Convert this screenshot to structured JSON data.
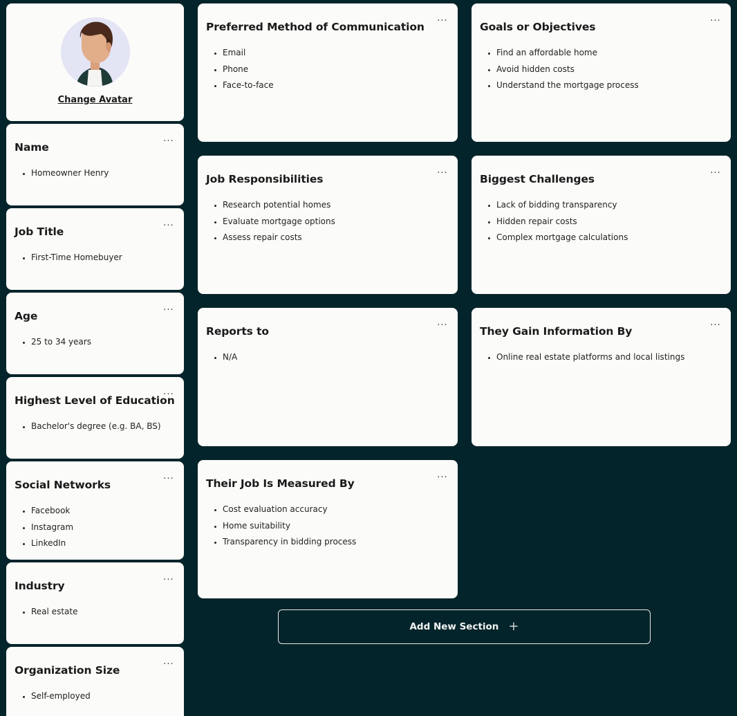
{
  "avatar": {
    "change_label": "Change Avatar"
  },
  "left_cards": [
    {
      "title": "Name",
      "items": [
        "Homeowner Henry"
      ]
    },
    {
      "title": "Job Title",
      "items": [
        "First-Time Homebuyer"
      ]
    },
    {
      "title": "Age",
      "items": [
        "25 to 34 years"
      ]
    },
    {
      "title": "Highest Level of Education",
      "items": [
        "Bachelor's degree (e.g. BA, BS)"
      ]
    },
    {
      "title": "Social Networks",
      "items": [
        "Facebook",
        "Instagram",
        "LinkedIn"
      ]
    },
    {
      "title": "Industry",
      "items": [
        "Real estate"
      ]
    },
    {
      "title": "Organization Size",
      "items": [
        "Self-employed"
      ]
    }
  ],
  "main_cards": [
    {
      "title": "Preferred Method of Communication",
      "items": [
        "Email",
        "Phone",
        "Face-to-face"
      ]
    },
    {
      "title": "Goals or Objectives",
      "items": [
        "Find an affordable home",
        "Avoid hidden costs",
        "Understand the mortgage process"
      ]
    },
    {
      "title": "Job Responsibilities",
      "items": [
        "Research potential homes",
        "Evaluate mortgage options",
        "Assess repair costs"
      ]
    },
    {
      "title": "Biggest Challenges",
      "items": [
        "Lack of bidding transparency",
        "Hidden repair costs",
        "Complex mortgage calculations"
      ]
    },
    {
      "title": "Reports to",
      "items": [
        "N/A"
      ]
    },
    {
      "title": "They Gain Information By",
      "items": [
        "Online real estate platforms and local listings"
      ]
    },
    {
      "title": "Their Job Is Measured By",
      "items": [
        "Cost evaluation accuracy",
        "Home suitability",
        "Transparency in bidding process"
      ]
    }
  ],
  "menu_glyph": "···",
  "add_section": {
    "label": "Add New Section",
    "plus": "+"
  }
}
